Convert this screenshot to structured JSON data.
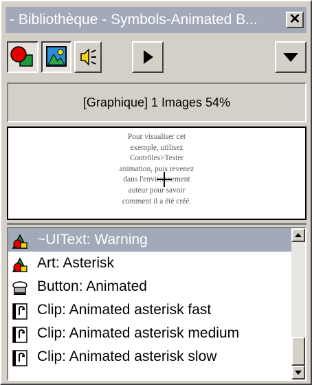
{
  "window": {
    "title": "- Bibliothèque - Symbols-Animated B...",
    "close_label": "✕",
    "colors": {
      "titlebar": "#a2aab9",
      "face": "#d4d0c8",
      "selection": "#a2aab9"
    }
  },
  "toolbar": {
    "buttons": [
      {
        "name": "graphic-symbol-icon",
        "pressed": true
      },
      {
        "name": "bitmap-icon",
        "pressed": true
      },
      {
        "name": "sound-icon",
        "pressed": false
      },
      {
        "name": "play-icon",
        "pressed": false
      },
      {
        "name": "options-menu-icon",
        "pressed": false
      }
    ]
  },
  "status": {
    "text": "[Graphique] 1 Images  54%"
  },
  "preview": {
    "lines": [
      "Pour visualiser cet",
      "exemple, utilisez",
      "Contrôles>Tester",
      "animation, puis revenez",
      "dans l'environnement",
      "auteur pour savoir",
      "comment il a été créé."
    ]
  },
  "library": {
    "items": [
      {
        "label": "~UIText: Warning",
        "icon": "graphic-symbol-icon",
        "selected": true
      },
      {
        "label": "Art: Asterisk",
        "icon": "graphic-symbol-icon",
        "selected": false
      },
      {
        "label": "Button: Animated",
        "icon": "button-symbol-icon",
        "selected": false
      },
      {
        "label": "Clip: Animated asterisk fast",
        "icon": "movie-clip-icon",
        "selected": false
      },
      {
        "label": "Clip: Animated asterisk medium",
        "icon": "movie-clip-icon",
        "selected": false
      },
      {
        "label": "Clip: Animated asterisk slow",
        "icon": "movie-clip-icon",
        "selected": false
      }
    ]
  }
}
